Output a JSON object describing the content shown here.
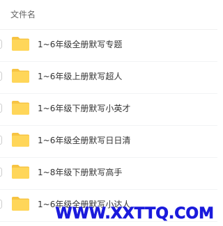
{
  "header": {
    "column_name": "文件名"
  },
  "files": [
    {
      "name": "1~6年级全册默写专题",
      "icon": "folder-icon"
    },
    {
      "name": "1~6年级上册默写超人",
      "icon": "folder-icon"
    },
    {
      "name": "1~6年级下册默写小英才",
      "icon": "folder-icon"
    },
    {
      "name": "1~6年级全册默写日日清",
      "icon": "folder-icon"
    },
    {
      "name": "1~8年级下册默写高手",
      "icon": "folder-icon"
    },
    {
      "name": "1~6年级全册默写小达人",
      "icon": "folder-icon"
    }
  ],
  "watermark": "WWW.XXTTQ.COM",
  "colors": {
    "folder": "#ffd659",
    "folder_tab": "#f7c443",
    "watermark": "#1a1adc"
  }
}
